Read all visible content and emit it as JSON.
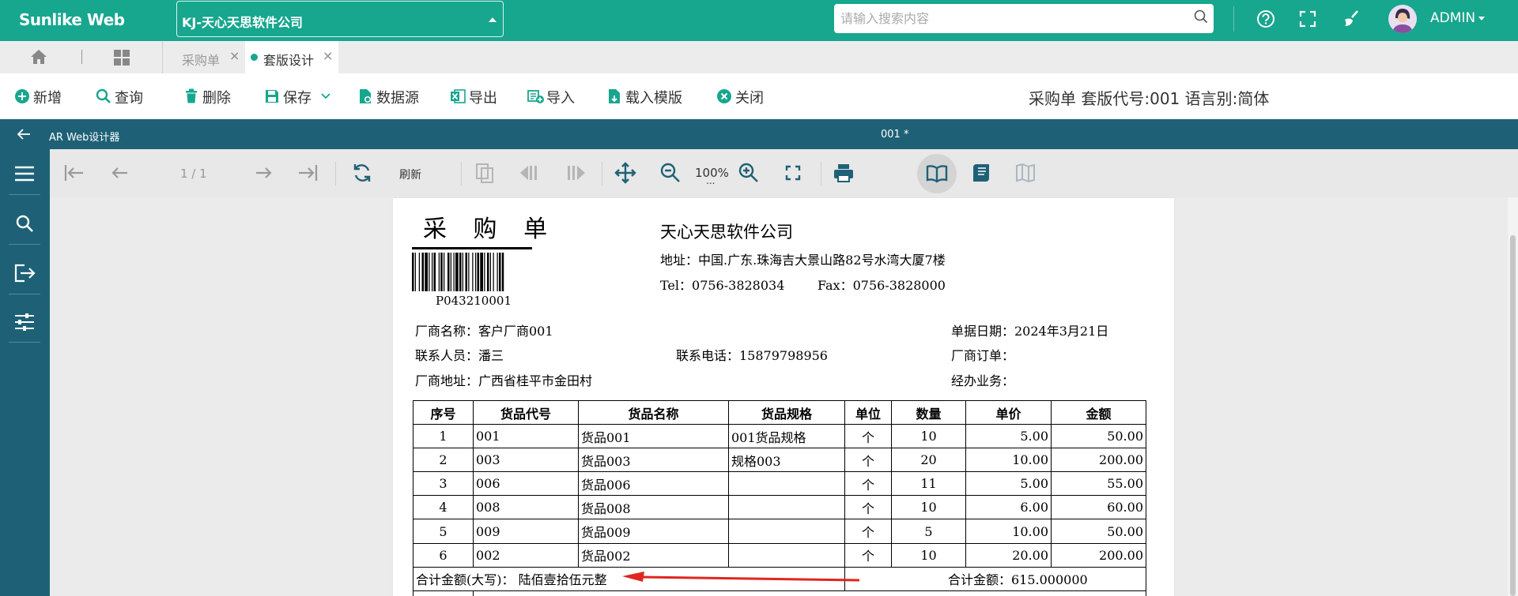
{
  "header": {
    "brand": "Sunlike Web",
    "company": "KJ-天心天思软件公司",
    "search_placeholder": "请输入搜索内容",
    "user": "ADMIN"
  },
  "tabs": [
    {
      "label": "采购单",
      "active": false
    },
    {
      "label": "套版设计",
      "active": true
    }
  ],
  "toolbar": {
    "buttons": [
      "新增",
      "查询",
      "删除",
      "保存",
      "数据源",
      "导出",
      "导入",
      "载入模版",
      "关闭"
    ],
    "title_info": "采购单 套版代号:001 语言别:简体"
  },
  "designer": {
    "title": "AR Web设计器",
    "doc_name": "001 *"
  },
  "viewer": {
    "page": "1 / 1",
    "refresh_label": "刷新",
    "zoom": "100%",
    "zoom_more": "..."
  },
  "document": {
    "title": "采 购 单",
    "barcode_number": "P043210001",
    "company_name": "天心天思软件公司",
    "address": "地址：中国.广东.珠海吉大景山路82号水湾大厦7楼",
    "tel": "Tel：0756-3828034",
    "fax": "Fax：0756-3828000",
    "vendor_name": "厂商名称：客户厂商001",
    "contact": "联系人员：潘三",
    "vendor_address": "厂商地址：广西省桂平市金田村",
    "phone": "联系电话：15879798956",
    "bill_date": "单据日期：2024年3月21日",
    "vendor_order": "厂商订单：",
    "handler": "经办业务：",
    "columns": [
      "序号",
      "货品代号",
      "货品名称",
      "货品规格",
      "单位",
      "数量",
      "单价",
      "金额"
    ],
    "rows": [
      [
        "1",
        "001",
        "货品001",
        "001货品规格",
        "个",
        "10",
        "5.00",
        "50.00"
      ],
      [
        "2",
        "003",
        "货品003",
        "规格003",
        "个",
        "20",
        "10.00",
        "200.00"
      ],
      [
        "3",
        "006",
        "货品006",
        "",
        "个",
        "11",
        "5.00",
        "55.00"
      ],
      [
        "4",
        "008",
        "货品008",
        "",
        "个",
        "10",
        "6.00",
        "60.00"
      ],
      [
        "5",
        "009",
        "货品009",
        "",
        "个",
        "5",
        "10.00",
        "50.00"
      ],
      [
        "6",
        "002",
        "货品002",
        "",
        "个",
        "10",
        "20.00",
        "200.00"
      ]
    ],
    "total_words": "合计金额(大写)：  陆佰壹拾伍元整",
    "total_amount": "合计金额：615.000000"
  },
  "colors": {
    "brand_green": "#17a68e",
    "designer_teal": "#1e6176",
    "annotation_arrow": "#e0261f"
  }
}
